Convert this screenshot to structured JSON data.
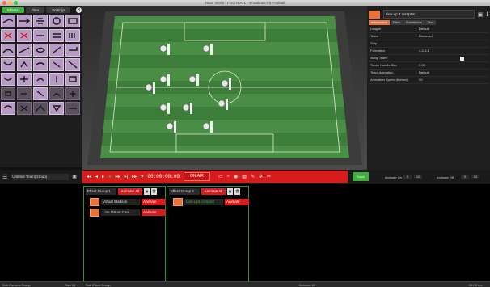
{
  "window": {
    "title": "Nous Vizics - FOOTBALL - Broadcast Kit Football"
  },
  "left_panel": {
    "tabs": [
      "Effects",
      "Files",
      "Settings"
    ],
    "palette_count": 35
  },
  "right_panel": {
    "name": "Line-up 4 comptot",
    "tabs": [
      "Information",
      "Pitch",
      "Substitutes",
      "Text"
    ],
    "properties": [
      {
        "key": "League",
        "value": "Default"
      },
      {
        "key": "Team",
        "value": "Unnamed"
      },
      {
        "key": "Strip",
        "value": ""
      },
      {
        "key": "Formation",
        "value": "4-2-3-1"
      },
      {
        "key": "Away Team",
        "value": ""
      },
      {
        "key": "Touch Handle Size",
        "value": "2.00"
      },
      {
        "key": "Team Animation",
        "value": "Default"
      },
      {
        "key": "Animation Speed (frames)",
        "value": "30"
      }
    ]
  },
  "control_bar": {
    "scene_name": "Untitled Team(Group)",
    "timecode": "00:00:00:00",
    "on_air": "ON AIR",
    "green_button": "Touch",
    "animate_on_label": "Animate On",
    "animate_on_value": "0",
    "animate_on_units": "10",
    "animate_off_label": "Animate Off",
    "animate_off_value": "0",
    "animate_off_units": "10"
  },
  "effects": {
    "groups": [
      {
        "name": "Effect Group 1",
        "animate": "Animate All",
        "items": [
          {
            "name": "Virtual Stadium",
            "anim": "Animate"
          },
          {
            "name": "Lion Virtual Cam...",
            "anim": "Animate"
          }
        ]
      },
      {
        "name": "Effect Group 2",
        "animate": "Animate All",
        "items": [
          {
            "name": "Line-up4 comptot",
            "anim": "Animate"
          }
        ]
      }
    ]
  },
  "status": {
    "left": "Sub Camera Group",
    "left2": "Disc 01",
    "mid": "Sub Effect Group",
    "right": "Animate All",
    "fps": "25.00 fps"
  },
  "colors": {
    "accent_green": "#3fae3f",
    "accent_red": "#d81b1b",
    "accent_orange": "#e8743a"
  }
}
